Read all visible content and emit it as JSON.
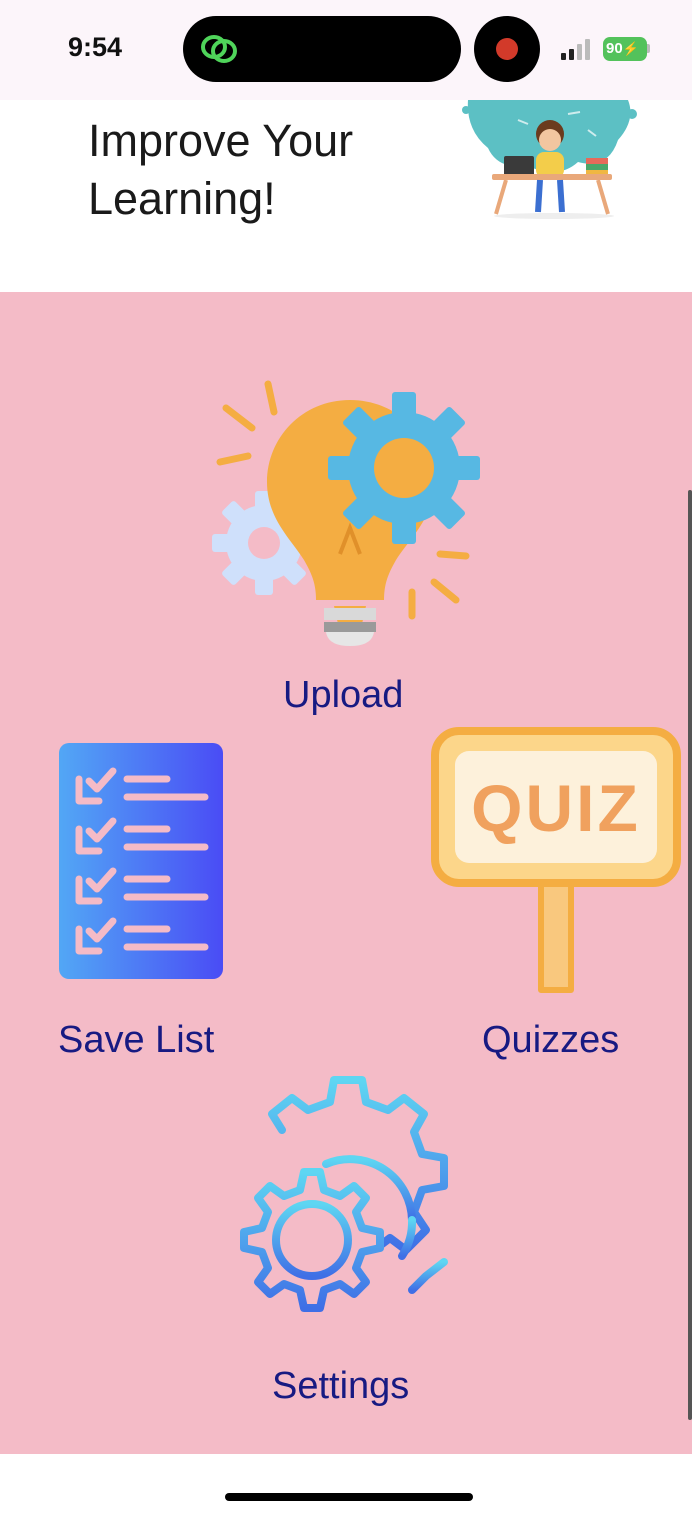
{
  "status_bar": {
    "time": "9:54",
    "battery": "90",
    "app_icon": "chain-link-icon",
    "recording_icon": "record-dot-icon",
    "signal_icon": "cellular-signal-icon"
  },
  "banner": {
    "title": "Improve Your Learning!",
    "illustration": "student-at-desk-illustration"
  },
  "menu": {
    "upload": {
      "label": "Upload",
      "icon": "lightbulb-gears-icon"
    },
    "save_list": {
      "label": "Save List",
      "icon": "checklist-icon"
    },
    "quizzes": {
      "label": "Quizzes",
      "icon": "quiz-sign-icon",
      "sign_text": "QUIZ"
    },
    "settings": {
      "label": "Settings",
      "icon": "gears-icon"
    }
  },
  "colors": {
    "background": "#f4bbc7",
    "label_text": "#171a82",
    "status_bar": "#fcf5fa"
  }
}
